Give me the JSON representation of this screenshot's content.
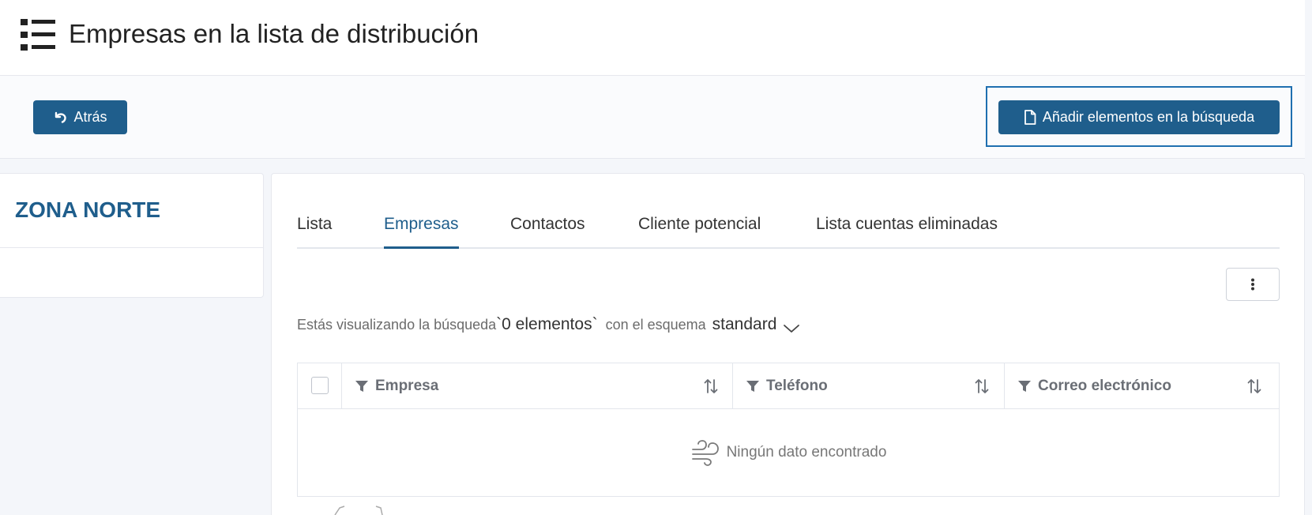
{
  "header": {
    "title": "Empresas en la lista de distribución",
    "icon": "list-icon"
  },
  "toolbar": {
    "back_label": "Atrás",
    "add_label": "Añadir elementos en la búsqueda",
    "accent_color": "#1f5e8c"
  },
  "left_panel": {
    "title": "ZONA NORTE"
  },
  "tabs": [
    {
      "label": "Lista",
      "active": false
    },
    {
      "label": "Empresas",
      "active": true
    },
    {
      "label": "Contactos",
      "active": false
    },
    {
      "label": "Cliente potencial",
      "active": false
    },
    {
      "label": "Lista cuentas eliminadas",
      "active": false
    }
  ],
  "search_info": {
    "prefix": "Estás visualizando la búsqueda",
    "search_name": "`0 elementos`",
    "schema_prefix": "con el esquema",
    "schema_name": "standard"
  },
  "table": {
    "columns": [
      {
        "label": "Empresa"
      },
      {
        "label": "Teléfono"
      },
      {
        "label": "Correo electrónico"
      }
    ],
    "empty_message": "Ningún dato encontrado"
  }
}
